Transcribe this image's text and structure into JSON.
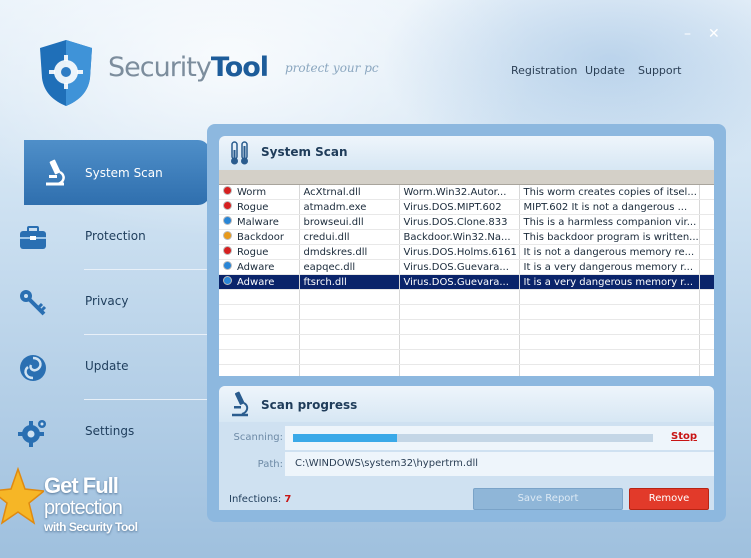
{
  "header": {
    "logo_light": "Security",
    "logo_bold": "Tool",
    "tagline": "protect your pc",
    "links": [
      "Registration",
      "Update",
      "Support"
    ],
    "minimize": "–",
    "close": "✕"
  },
  "sidebar": {
    "items": [
      {
        "label": "System Scan",
        "icon": "microscope-icon",
        "active": true
      },
      {
        "label": "Protection",
        "icon": "briefcase-icon",
        "active": false
      },
      {
        "label": "Privacy",
        "icon": "keys-icon",
        "active": false
      },
      {
        "label": "Update",
        "icon": "swirl-icon",
        "active": false
      },
      {
        "label": "Settings",
        "icon": "gear-icon",
        "active": false
      }
    ]
  },
  "promo": {
    "line1": "Get Full",
    "line2": "protection",
    "line3": "with Security Tool"
  },
  "scan_panel": {
    "title": "System Scan",
    "rows": [
      {
        "type": "Worm",
        "file": "AcXtrnal.dll",
        "name": "Worm.Win32.Autor...",
        "desc": "This worm creates copies of itsel...",
        "dot": "#d62020",
        "selected": false
      },
      {
        "type": "Rogue",
        "file": "atmadm.exe",
        "name": "Virus.DOS.MIPT.602",
        "desc": "MIPT.602 It is not a dangerous ...",
        "dot": "#d62020",
        "selected": false
      },
      {
        "type": "Malware",
        "file": "browseui.dll",
        "name": "Virus.DOS.Clone.833",
        "desc": "This is a harmless companion vir...",
        "dot": "#2a86d6",
        "selected": false
      },
      {
        "type": "Backdoor",
        "file": "credui.dll",
        "name": "Backdoor.Win32.Na...",
        "desc": "This backdoor program is written...",
        "dot": "#e89a1c",
        "selected": false
      },
      {
        "type": "Rogue",
        "file": "dmdskres.dll",
        "name": "Virus.DOS.Holms.6161",
        "desc": "It is not a dangerous memory re...",
        "dot": "#d62020",
        "selected": false
      },
      {
        "type": "Adware",
        "file": "eapqec.dll",
        "name": "Virus.DOS.Guevara...",
        "desc": "It is a very dangerous memory r...",
        "dot": "#2a86d6",
        "selected": false
      },
      {
        "type": "Adware",
        "file": "ftsrch.dll",
        "name": "Virus.DOS.Guevara...",
        "desc": "It is a very dangerous memory r...",
        "dot": "#2a86d6",
        "selected": true
      }
    ]
  },
  "progress_panel": {
    "title": "Scan progress",
    "scanning_label": "Scanning:",
    "progress_fraction": 0.29,
    "stop_label": "Stop",
    "path_label": "Path:",
    "path_value": "C:\\WINDOWS\\system32\\hypertrm.dll",
    "infections_label": "Infections:",
    "infections_count": "7",
    "save_report": "Save Report",
    "remove": "Remove"
  },
  "colors": {
    "accent": "#2f6fae",
    "danger": "#e23a2a",
    "selection": "#0a246a",
    "progress": "#3aa9e8"
  }
}
